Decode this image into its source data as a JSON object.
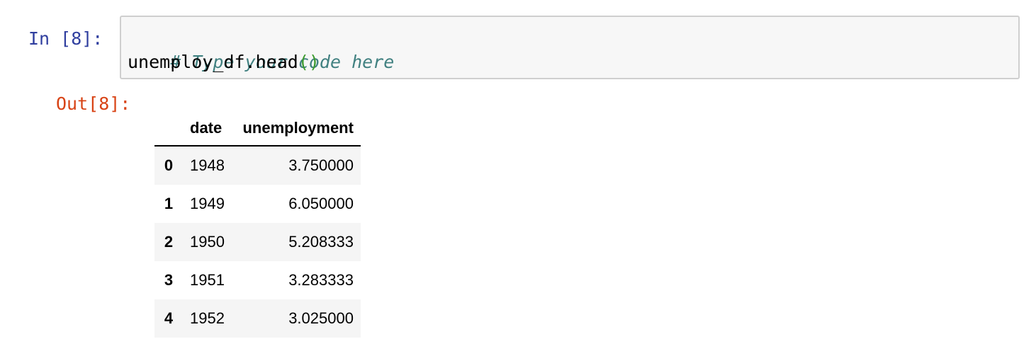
{
  "input_cell": {
    "prompt": "In [8]:",
    "code_comment": "# Type your code here",
    "code_call": "unemploy_df.head",
    "code_parens": "()"
  },
  "output_cell": {
    "prompt": "Out[8]:",
    "table": {
      "columns": [
        "date",
        "unemployment"
      ],
      "rows": [
        {
          "index": "0",
          "date": "1948",
          "unemployment": "3.750000"
        },
        {
          "index": "1",
          "date": "1949",
          "unemployment": "6.050000"
        },
        {
          "index": "2",
          "date": "1950",
          "unemployment": "5.208333"
        },
        {
          "index": "3",
          "date": "1951",
          "unemployment": "3.283333"
        },
        {
          "index": "4",
          "date": "1952",
          "unemployment": "3.025000"
        }
      ]
    }
  },
  "colors": {
    "in_prompt": "#303f9f",
    "out_prompt": "#d84315",
    "comment": "#408080",
    "paren": "#3d9b2e",
    "cell_background": "#f7f7f7",
    "cell_border": "#cfcfcf"
  }
}
